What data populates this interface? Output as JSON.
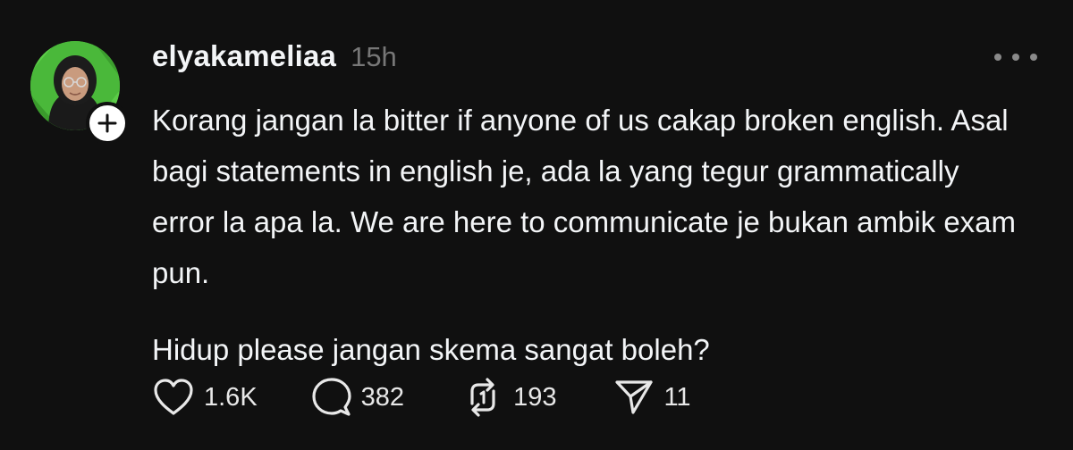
{
  "post": {
    "username": "elyakameliaa",
    "timestamp": "15h",
    "body": {
      "paragraph_1": "Korang jangan la bitter if anyone of us cakap broken english. Asal bagi statements in english je, ada la yang tegur grammatically error la apa la. We are here to communicate je bukan ambik exam pun.",
      "paragraph_2": "Hidup please jangan skema sangat boleh?"
    },
    "actions": {
      "likes": "1.6K",
      "replies": "382",
      "reposts": "193",
      "shares": "11"
    },
    "icons": {
      "avatar": "profile-photo",
      "follow": "plus-icon",
      "more": "more-horizontal-icon",
      "like": "heart-icon",
      "reply": "comment-bubble-icon",
      "repost": "repost-arrows-icon",
      "share": "send-paper-plane-icon"
    },
    "colors": {
      "background": "#101010",
      "text_primary": "#f3f5f7",
      "text_secondary": "#777777",
      "avatar_bg": "#4ab83a"
    }
  }
}
